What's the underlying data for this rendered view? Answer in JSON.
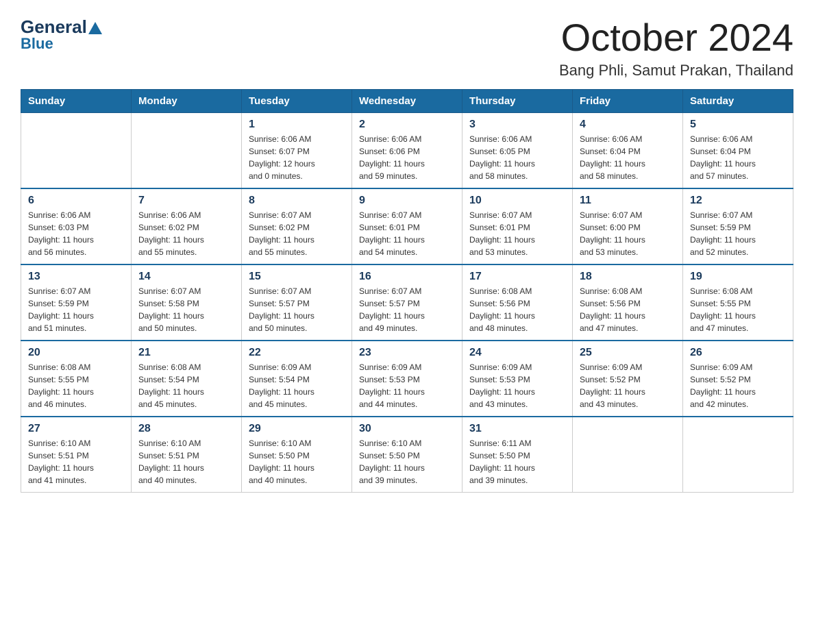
{
  "logo": {
    "general": "General",
    "blue": "Blue"
  },
  "title": "October 2024",
  "subtitle": "Bang Phli, Samut Prakan, Thailand",
  "headers": [
    "Sunday",
    "Monday",
    "Tuesday",
    "Wednesday",
    "Thursday",
    "Friday",
    "Saturday"
  ],
  "weeks": [
    [
      {
        "day": "",
        "info": ""
      },
      {
        "day": "",
        "info": ""
      },
      {
        "day": "1",
        "info": "Sunrise: 6:06 AM\nSunset: 6:07 PM\nDaylight: 12 hours\nand 0 minutes."
      },
      {
        "day": "2",
        "info": "Sunrise: 6:06 AM\nSunset: 6:06 PM\nDaylight: 11 hours\nand 59 minutes."
      },
      {
        "day": "3",
        "info": "Sunrise: 6:06 AM\nSunset: 6:05 PM\nDaylight: 11 hours\nand 58 minutes."
      },
      {
        "day": "4",
        "info": "Sunrise: 6:06 AM\nSunset: 6:04 PM\nDaylight: 11 hours\nand 58 minutes."
      },
      {
        "day": "5",
        "info": "Sunrise: 6:06 AM\nSunset: 6:04 PM\nDaylight: 11 hours\nand 57 minutes."
      }
    ],
    [
      {
        "day": "6",
        "info": "Sunrise: 6:06 AM\nSunset: 6:03 PM\nDaylight: 11 hours\nand 56 minutes."
      },
      {
        "day": "7",
        "info": "Sunrise: 6:06 AM\nSunset: 6:02 PM\nDaylight: 11 hours\nand 55 minutes."
      },
      {
        "day": "8",
        "info": "Sunrise: 6:07 AM\nSunset: 6:02 PM\nDaylight: 11 hours\nand 55 minutes."
      },
      {
        "day": "9",
        "info": "Sunrise: 6:07 AM\nSunset: 6:01 PM\nDaylight: 11 hours\nand 54 minutes."
      },
      {
        "day": "10",
        "info": "Sunrise: 6:07 AM\nSunset: 6:01 PM\nDaylight: 11 hours\nand 53 minutes."
      },
      {
        "day": "11",
        "info": "Sunrise: 6:07 AM\nSunset: 6:00 PM\nDaylight: 11 hours\nand 53 minutes."
      },
      {
        "day": "12",
        "info": "Sunrise: 6:07 AM\nSunset: 5:59 PM\nDaylight: 11 hours\nand 52 minutes."
      }
    ],
    [
      {
        "day": "13",
        "info": "Sunrise: 6:07 AM\nSunset: 5:59 PM\nDaylight: 11 hours\nand 51 minutes."
      },
      {
        "day": "14",
        "info": "Sunrise: 6:07 AM\nSunset: 5:58 PM\nDaylight: 11 hours\nand 50 minutes."
      },
      {
        "day": "15",
        "info": "Sunrise: 6:07 AM\nSunset: 5:57 PM\nDaylight: 11 hours\nand 50 minutes."
      },
      {
        "day": "16",
        "info": "Sunrise: 6:07 AM\nSunset: 5:57 PM\nDaylight: 11 hours\nand 49 minutes."
      },
      {
        "day": "17",
        "info": "Sunrise: 6:08 AM\nSunset: 5:56 PM\nDaylight: 11 hours\nand 48 minutes."
      },
      {
        "day": "18",
        "info": "Sunrise: 6:08 AM\nSunset: 5:56 PM\nDaylight: 11 hours\nand 47 minutes."
      },
      {
        "day": "19",
        "info": "Sunrise: 6:08 AM\nSunset: 5:55 PM\nDaylight: 11 hours\nand 47 minutes."
      }
    ],
    [
      {
        "day": "20",
        "info": "Sunrise: 6:08 AM\nSunset: 5:55 PM\nDaylight: 11 hours\nand 46 minutes."
      },
      {
        "day": "21",
        "info": "Sunrise: 6:08 AM\nSunset: 5:54 PM\nDaylight: 11 hours\nand 45 minutes."
      },
      {
        "day": "22",
        "info": "Sunrise: 6:09 AM\nSunset: 5:54 PM\nDaylight: 11 hours\nand 45 minutes."
      },
      {
        "day": "23",
        "info": "Sunrise: 6:09 AM\nSunset: 5:53 PM\nDaylight: 11 hours\nand 44 minutes."
      },
      {
        "day": "24",
        "info": "Sunrise: 6:09 AM\nSunset: 5:53 PM\nDaylight: 11 hours\nand 43 minutes."
      },
      {
        "day": "25",
        "info": "Sunrise: 6:09 AM\nSunset: 5:52 PM\nDaylight: 11 hours\nand 43 minutes."
      },
      {
        "day": "26",
        "info": "Sunrise: 6:09 AM\nSunset: 5:52 PM\nDaylight: 11 hours\nand 42 minutes."
      }
    ],
    [
      {
        "day": "27",
        "info": "Sunrise: 6:10 AM\nSunset: 5:51 PM\nDaylight: 11 hours\nand 41 minutes."
      },
      {
        "day": "28",
        "info": "Sunrise: 6:10 AM\nSunset: 5:51 PM\nDaylight: 11 hours\nand 40 minutes."
      },
      {
        "day": "29",
        "info": "Sunrise: 6:10 AM\nSunset: 5:50 PM\nDaylight: 11 hours\nand 40 minutes."
      },
      {
        "day": "30",
        "info": "Sunrise: 6:10 AM\nSunset: 5:50 PM\nDaylight: 11 hours\nand 39 minutes."
      },
      {
        "day": "31",
        "info": "Sunrise: 6:11 AM\nSunset: 5:50 PM\nDaylight: 11 hours\nand 39 minutes."
      },
      {
        "day": "",
        "info": ""
      },
      {
        "day": "",
        "info": ""
      }
    ]
  ]
}
